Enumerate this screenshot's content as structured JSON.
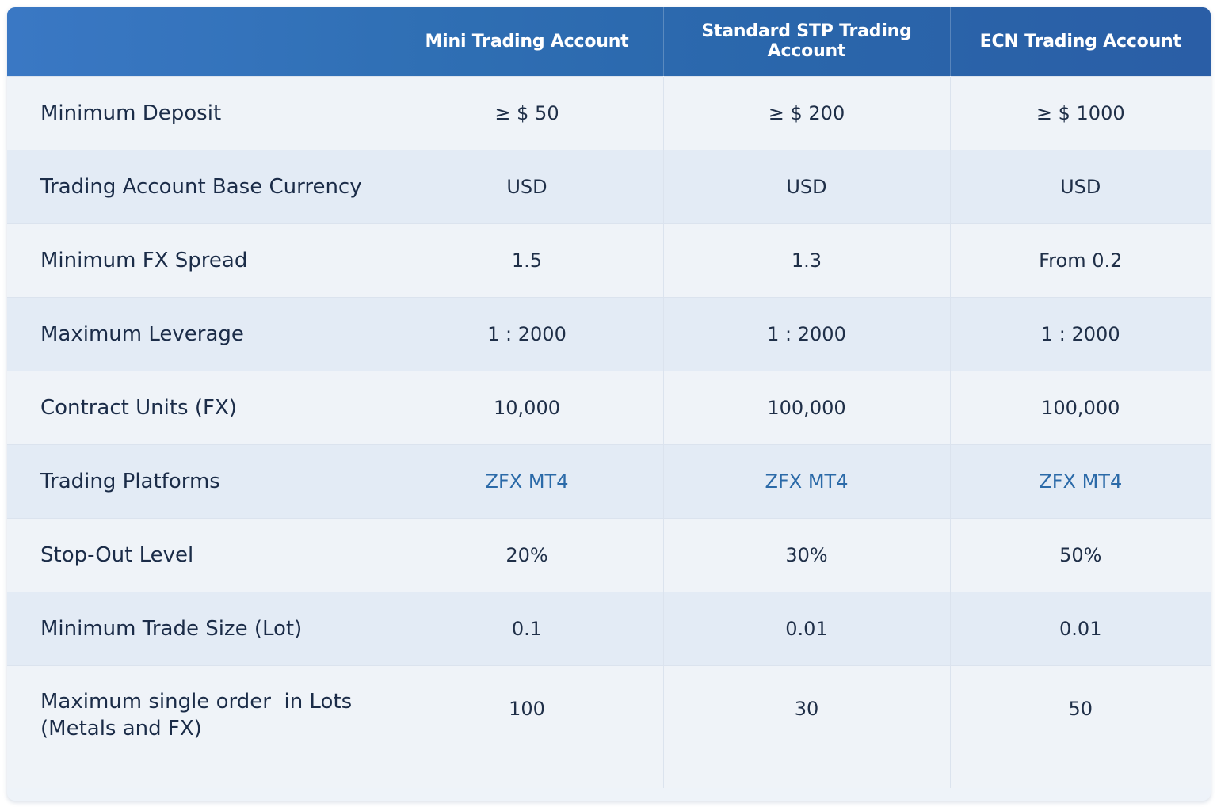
{
  "header": {
    "corner": "",
    "columns": [
      "Mini Trading Account",
      "Standard STP Trading Account",
      "ECN Trading Account"
    ]
  },
  "rows": [
    {
      "label": "Minimum Deposit",
      "values": [
        "≥ $ 50",
        "≥ $ 200",
        "≥ $ 1000"
      ]
    },
    {
      "label": "Trading Account Base Currency",
      "values": [
        "USD",
        "USD",
        "USD"
      ]
    },
    {
      "label": "Minimum FX Spread",
      "values": [
        "1.5",
        "1.3",
        "From 0.2"
      ]
    },
    {
      "label": "Maximum Leverage",
      "values": [
        "1 : 2000",
        "1 : 2000",
        "1 : 2000"
      ]
    },
    {
      "label": "Contract Units (FX)",
      "values": [
        "10,000",
        "100,000",
        "100,000"
      ]
    },
    {
      "label": "Trading Platforms",
      "values": [
        "ZFX MT4",
        "ZFX MT4",
        "ZFX MT4"
      ]
    },
    {
      "label": "Stop-Out Level",
      "values": [
        "20%",
        "30%",
        "50%"
      ]
    },
    {
      "label": "Minimum Trade Size (Lot)",
      "values": [
        "0.1",
        "0.01",
        "0.01"
      ]
    },
    {
      "label_line1": "Maximum single order  in Lots",
      "label_line2": "(Metals and FX)",
      "values": [
        "100",
        "30",
        "50"
      ]
    }
  ],
  "colors": {
    "header_start": "#3a78c4",
    "header_end": "#2a5ea6",
    "link": "#2b6aa8",
    "text": "#1b2c48"
  }
}
